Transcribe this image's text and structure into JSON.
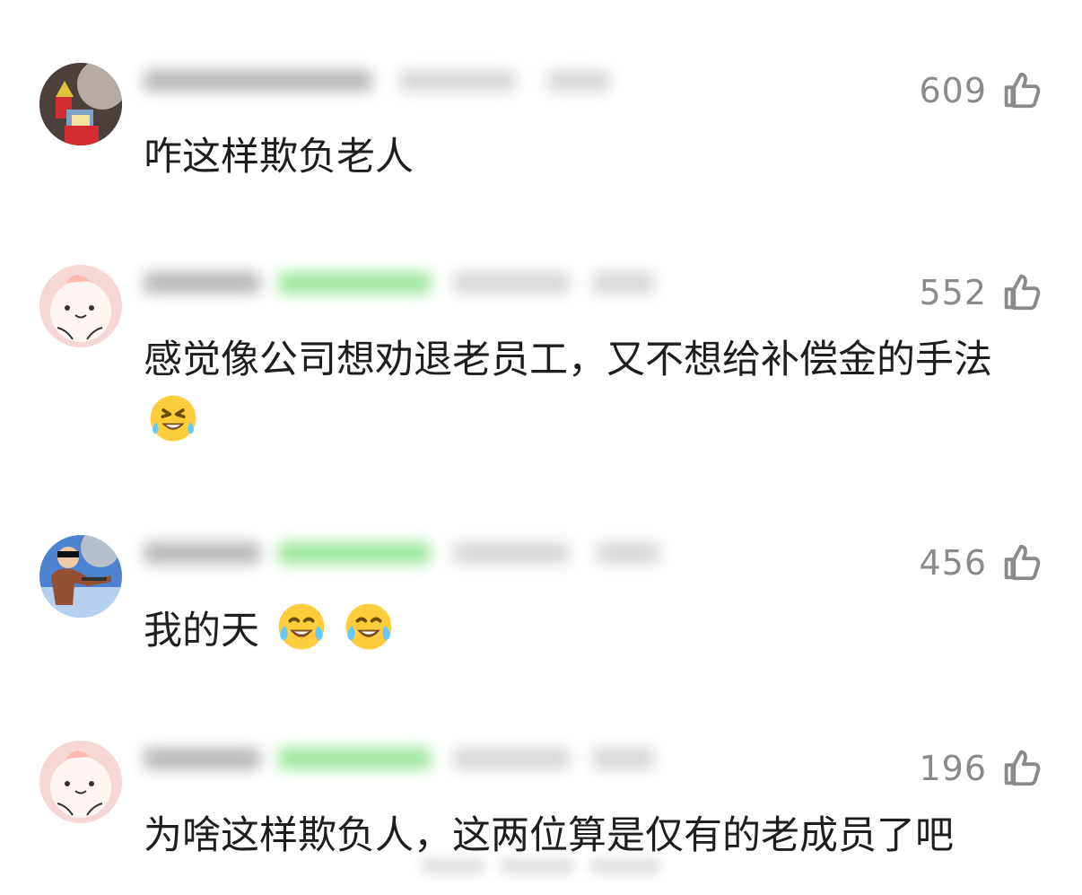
{
  "comments": [
    {
      "likes": "609",
      "text": "咋这样欺负老人",
      "emojis": []
    },
    {
      "likes": "552",
      "text": "感觉像公司想劝退老员工，又不想给补偿金的手法",
      "emojis": [
        "rolling-on-floor-laughing"
      ]
    },
    {
      "likes": "456",
      "text": "我的天",
      "emojis": [
        "tears-of-joy",
        "tears-of-joy"
      ]
    },
    {
      "likes": "196",
      "text": "为啥这样欺负人，这两位算是仅有的老成员了吧",
      "emojis": []
    }
  ],
  "colors": {
    "badge_green": "#9be79a",
    "like_gray": "#8a8a8a",
    "pink_avatar": "#f6d7d6"
  },
  "icons": {
    "like": "thumbs-up-outline-icon"
  }
}
